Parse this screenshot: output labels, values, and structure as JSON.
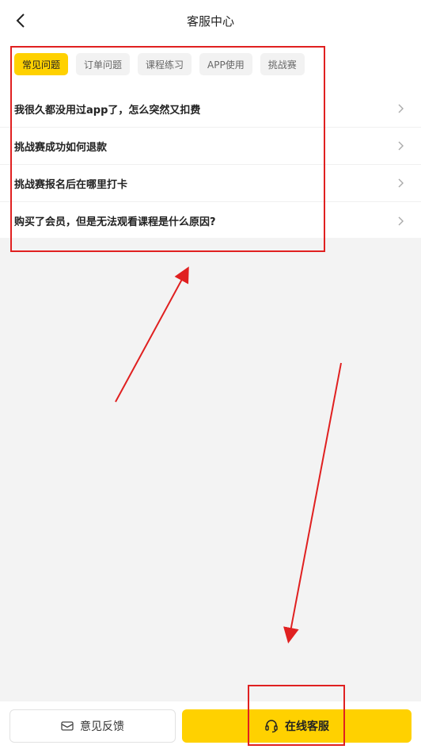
{
  "header": {
    "title": "客服中心",
    "back_icon": "chevron-left-icon"
  },
  "tabs": [
    {
      "label": "常见问题",
      "active": true
    },
    {
      "label": "订单问题",
      "active": false
    },
    {
      "label": "课程练习",
      "active": false
    },
    {
      "label": "APP使用",
      "active": false
    },
    {
      "label": "挑战赛",
      "active": false
    }
  ],
  "faq": [
    {
      "text": "我很久都没用过app了，怎么突然又扣费"
    },
    {
      "text": "挑战赛成功如何退款"
    },
    {
      "text": "挑战赛报名后在哪里打卡"
    },
    {
      "text": "购买了会员，但是无法观看课程是什么原因?"
    }
  ],
  "bottom": {
    "feedback_label": "意见反馈",
    "feedback_icon": "mail-icon",
    "service_label": "在线客服",
    "service_icon": "headset-icon"
  },
  "colors": {
    "accent": "#ffd100",
    "annotation": "#e02020"
  }
}
